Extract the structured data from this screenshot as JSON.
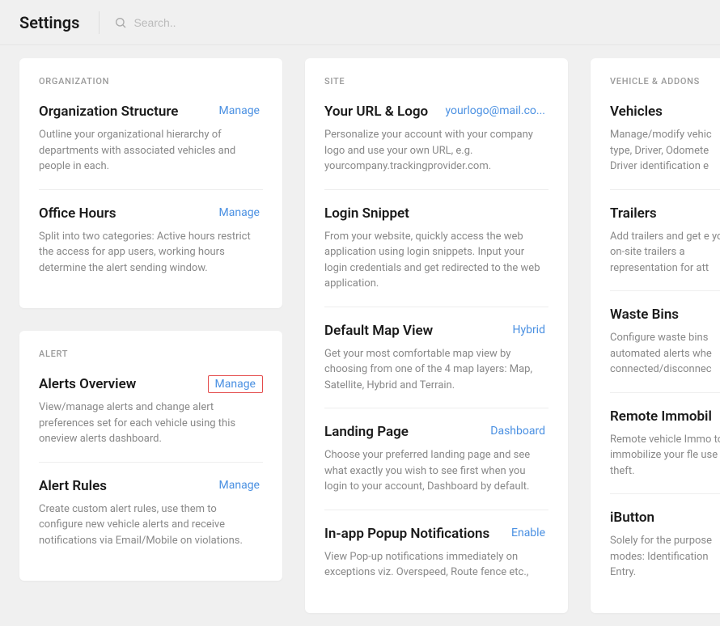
{
  "header": {
    "title": "Settings",
    "search_placeholder": "Search.."
  },
  "columns": [
    {
      "cards": [
        {
          "heading": "ORGANIZATION",
          "sections": [
            {
              "title": "Organization Structure",
              "action": "Manage",
              "desc": "Outline your organizational hierarchy of departments with associated vehicles and people in each."
            },
            {
              "title": "Office Hours",
              "action": "Manage",
              "desc": "Split into two categories: Active hours restrict the access for app users, working hours determine the alert sending window."
            }
          ]
        },
        {
          "heading": "ALERT",
          "sections": [
            {
              "title": "Alerts Overview",
              "action": "Manage",
              "highlighted": true,
              "desc": "View/manage alerts and change alert preferences set for each vehicle using this oneview alerts dashboard."
            },
            {
              "title": "Alert Rules",
              "action": "Manage",
              "desc": "Create custom alert rules, use them to configure new vehicle alerts and receive notifications via Email/Mobile on violations."
            }
          ]
        }
      ]
    },
    {
      "cards": [
        {
          "heading": "SITE",
          "sections": [
            {
              "title": "Your URL & Logo",
              "action": "yourlogo@mail.co...",
              "desc": "Personalize your account with your company logo and use your own URL, e.g. yourcompany.trackingprovider.com."
            },
            {
              "title": "Login Snippet",
              "action": "",
              "desc": "From your website, quickly access the web application using login snippets. Input your login credentials and get redirected to the web application."
            },
            {
              "title": "Default Map View",
              "action": "Hybrid",
              "desc": "Get your most comfortable map view by choosing from one of the 4 map layers: Map, Satellite, Hybrid and Terrain."
            },
            {
              "title": "Landing Page",
              "action": "Dashboard",
              "desc": "Choose your preferred landing page and see what exactly you wish to see first when you login to your account, Dashboard by default."
            },
            {
              "title": "In-app Popup Notifications",
              "action": "Enable",
              "desc": "View Pop-up notifications immediately on exceptions viz. Overspeed, Route fence etc.,"
            }
          ]
        }
      ]
    },
    {
      "cards": [
        {
          "heading": "VEHICLE & ADDONS",
          "sections": [
            {
              "title": "Vehicles",
              "action": "",
              "desc": "Manage/modify vehic type, Driver, Odomete Driver identification e"
            },
            {
              "title": "Trailers",
              "action": "",
              "desc": "Add trailers and get e your on-site trailers a representation for att"
            },
            {
              "title": "Waste Bins",
              "action": "",
              "desc": "Configure waste bins automated alerts whe connected/disconnec"
            },
            {
              "title": "Remote Immobil",
              "action": "",
              "desc": "Remote vehicle Immo to immobilize your fle use or theft."
            },
            {
              "title": "iButton",
              "action": "",
              "desc": "Solely for the purpose modes: Identification Entry."
            }
          ]
        }
      ]
    }
  ]
}
